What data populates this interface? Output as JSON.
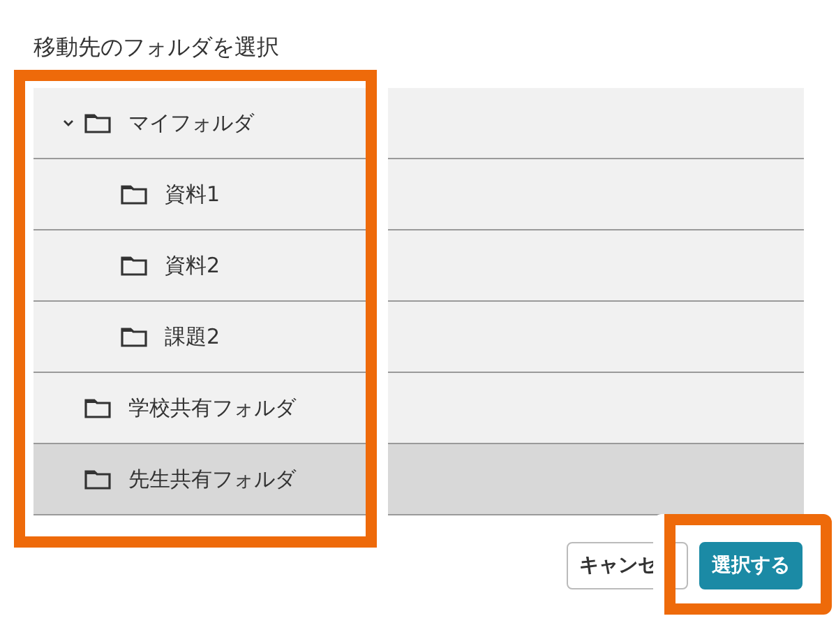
{
  "dialog": {
    "title": "移動先のフォルダを選択"
  },
  "folder_tree": {
    "highlighted": true,
    "items": [
      {
        "name": "マイフォルダ",
        "expanded": true,
        "selected": false,
        "children": [
          {
            "name": "資料1",
            "selected": false
          },
          {
            "name": "資料2",
            "selected": false
          },
          {
            "name": "課題2",
            "selected": false
          }
        ]
      },
      {
        "name": "学校共有フォルダ",
        "selected": false
      },
      {
        "name": "先生共有フォルダ",
        "selected": true
      }
    ]
  },
  "buttons": [
    {
      "label": "キャンセ",
      "kind": "secondary",
      "highlighted": false
    },
    {
      "label": "選択する",
      "kind": "primary",
      "highlighted": true
    }
  ]
}
